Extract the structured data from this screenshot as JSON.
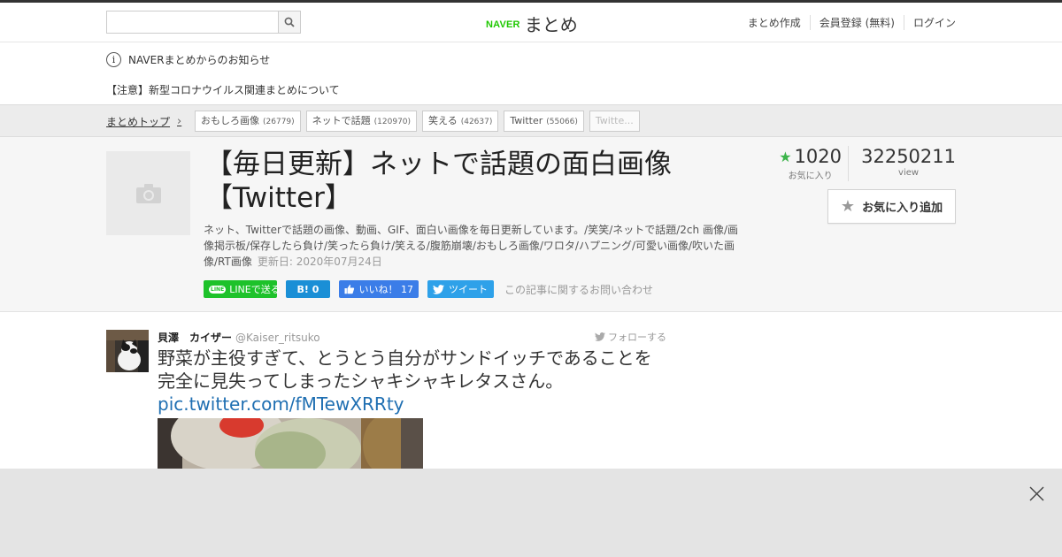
{
  "header": {
    "search_placeholder": "",
    "logo_naver": "NAVER",
    "logo_matome": "まとめ",
    "nav": [
      "まとめ作成",
      "会員登録 (無料)",
      "ログイン"
    ]
  },
  "notice": {
    "title": "NAVERまとめからのお知らせ",
    "link": "【注意】新型コロナウイルス関連まとめについて"
  },
  "breadcrumb": {
    "top": "まとめトップ",
    "tags": [
      {
        "label": "おもしろ画像",
        "count": "(26779)"
      },
      {
        "label": "ネットで話題",
        "count": "(120970)"
      },
      {
        "label": "笑える",
        "count": "(42637)"
      },
      {
        "label": "Twitter",
        "count": "(55066)"
      },
      {
        "label": "Twitte...",
        "count": ""
      }
    ]
  },
  "article": {
    "title": "【毎日更新】ネットで話題の面白画像【Twitter】",
    "description": "ネット、Twitterで話題の画像、動画、GIF、面白い画像を毎日更新しています。/笑笑/ネットで話題/2ch 画像/画像掲示板/保存したら負け/笑ったら負け/笑える/腹筋崩壊/おもしろ画像/ワロタ/ハプニング/可愛い画像/吹いた画像/RT画像",
    "updated": "更新日: 2020年07月24日",
    "favorites": "1020",
    "favorites_label": "お気に入り",
    "views": "32250211",
    "views_label": "view",
    "fav_button": "お気に入り追加",
    "share": {
      "line": "LINEで送る",
      "line_logo": "LINE",
      "hatena": "B! 0",
      "facebook": "いいね！ 17",
      "twitter": "ツイート"
    },
    "inquiry": "この記事に関するお問い合わせ"
  },
  "tweet": {
    "name": "貝澤　カイザー",
    "handle": "@Kaiser_ritsuko",
    "follow": "フォローする",
    "text_line1": "野菜が主役すぎて、とうとう自分がサンドイッチであることを",
    "text_line2": "完全に見失ってしまったシャキシャキレタスさん。",
    "link": "pic.twitter.com/fMTewXRRty"
  },
  "colors": {
    "accent_green": "#1ec800",
    "star_green": "#3cb44a",
    "link_blue": "#1f6fb2",
    "line_green": "#1dc22a",
    "hatena_blue": "#1a8fd6",
    "facebook_blue": "#3b7de8",
    "twitter_blue": "#2ea1e9"
  },
  "icons": [
    "search-icon",
    "info-icon",
    "chevron-right-icon",
    "camera-icon",
    "star-icon",
    "twitter-bird-icon",
    "facebook-like-icon",
    "close-icon"
  ]
}
